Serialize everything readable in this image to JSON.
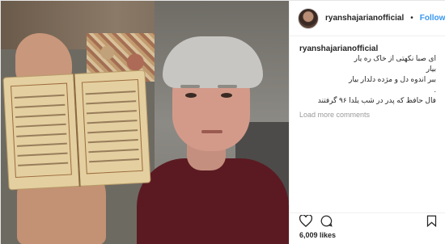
{
  "post": {
    "username": "ryanshajarianofficial",
    "separator": "•",
    "follow_label": "Follow",
    "caption": {
      "username": "ryanshajarianofficial",
      "lines": [
        "ای صبا نکهتی از خاک ره یار",
        "بیار",
        "ببر اندوه دل و مژده دلدار بیار",
        ".",
        "فال حافظ که پدر در شب یلدا ۹۶ گرفتند"
      ],
      "load_more": "Load more comments"
    },
    "likes": "6,009 likes"
  },
  "icons": {
    "like": "heart-icon",
    "comment": "comment-icon",
    "save": "bookmark-icon"
  }
}
